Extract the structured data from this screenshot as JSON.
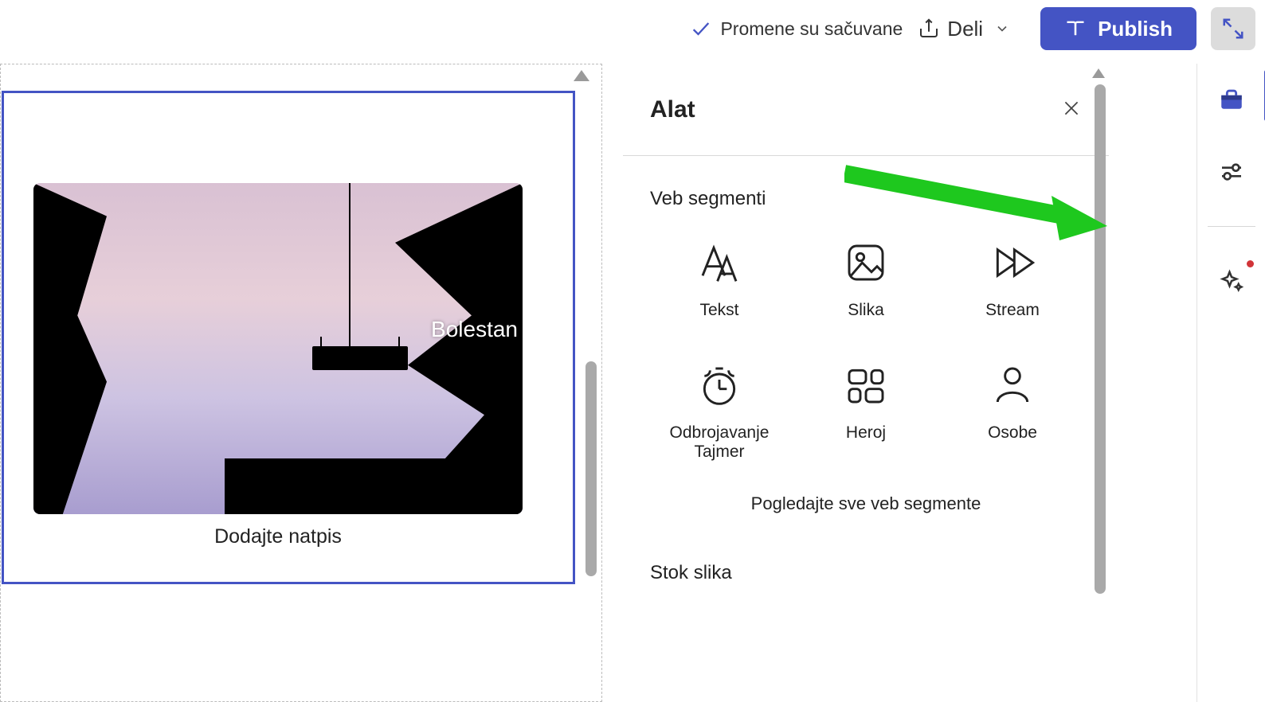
{
  "topbar": {
    "saved_status": "Promene su sačuvane",
    "share_label": "Deli",
    "publish_label": "Publish"
  },
  "canvas": {
    "hero_text": "Bolestan",
    "caption_placeholder": "Dodajte natpis"
  },
  "panel": {
    "title": "Alat",
    "web_parts_section": "Veb segmenti",
    "see_all": "Pogledajte sve veb segmente",
    "stock_section": "Stok slika",
    "items": [
      {
        "label": "Tekst",
        "icon": "text-icon"
      },
      {
        "label": "Slika",
        "icon": "image-icon"
      },
      {
        "label": "Stream",
        "icon": "stream-icon"
      },
      {
        "label": "Odbrojavanje Tajmer",
        "icon": "timer-icon"
      },
      {
        "label": "Heroj",
        "icon": "hero-icon"
      },
      {
        "label": "Osobe",
        "icon": "people-icon"
      }
    ]
  },
  "rail": {
    "toolbox": "toolbox-icon",
    "properties": "sliders-icon",
    "design": "sparkle-icon"
  }
}
